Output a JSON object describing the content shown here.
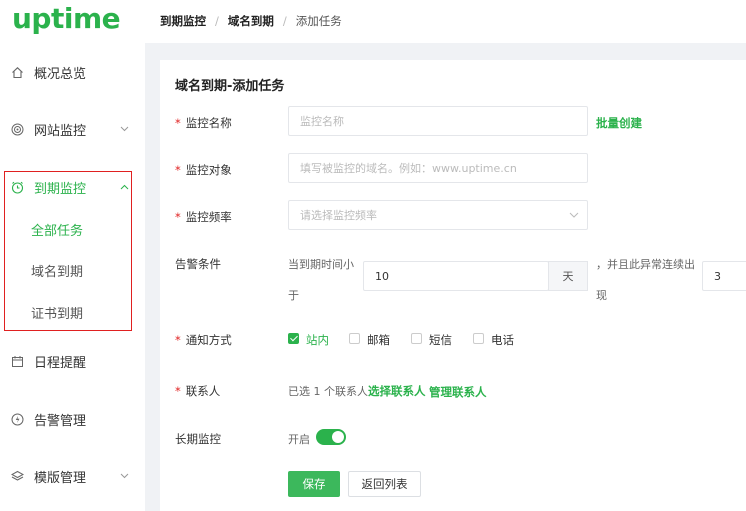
{
  "brand": {
    "logo": "uptime",
    "color": "#2bb24c"
  },
  "sidebar": {
    "items": [
      {
        "label": "概况总览",
        "icon": "home-icon",
        "has_chevron": false
      },
      {
        "label": "网站监控",
        "icon": "radar-icon",
        "has_chevron": true,
        "chevron": "⌄"
      },
      {
        "label": "到期监控",
        "icon": "alarm-clock-icon",
        "has_chevron": true,
        "chevron": "⌃",
        "active": true
      },
      {
        "label": "日程提醒",
        "icon": "calendar-icon",
        "has_chevron": false
      },
      {
        "label": "告警管理",
        "icon": "lightning-icon",
        "has_chevron": false
      },
      {
        "label": "模版管理",
        "icon": "layers-icon",
        "has_chevron": true,
        "chevron": "⌄"
      }
    ],
    "sub_items": [
      {
        "label": "全部任务",
        "active": true
      },
      {
        "label": "域名到期",
        "active": false
      },
      {
        "label": "证书到期",
        "active": false
      }
    ]
  },
  "breadcrumb": [
    "到期监控",
    "域名到期",
    "添加任务"
  ],
  "breadcrumb_sep": "/",
  "form": {
    "title": "域名到期-添加任务",
    "monitor_name": {
      "label": "监控名称",
      "placeholder": "监控名称",
      "link": "批量创建"
    },
    "monitor_target": {
      "label": "监控对象",
      "placeholder": "填写被监控的域名。例如：www.uptime.cn"
    },
    "monitor_freq": {
      "label": "监控频率",
      "placeholder": "请选择监控频率"
    },
    "alert": {
      "label": "告警条件",
      "text1_a": "当到期时间小",
      "text1_b": "于",
      "days_value": "10",
      "days_unit": "天",
      "text2_a": "，并且此异常连续出",
      "text2_b": "现",
      "count_value": "3"
    },
    "notify": {
      "label": "通知方式",
      "options": [
        {
          "label": "站内",
          "checked": true
        },
        {
          "label": "邮箱",
          "checked": false
        },
        {
          "label": "短信",
          "checked": false
        },
        {
          "label": "电话",
          "checked": false
        }
      ]
    },
    "contacts": {
      "label": "联系人",
      "selected_text": "已选 1 个联系人",
      "select_link": "选择联系人",
      "manage_link": "管理联系人"
    },
    "long_term": {
      "label": "长期监控",
      "toggle_text": "开启",
      "enabled": true
    },
    "buttons": {
      "save": "保存",
      "back": "返回列表"
    }
  }
}
